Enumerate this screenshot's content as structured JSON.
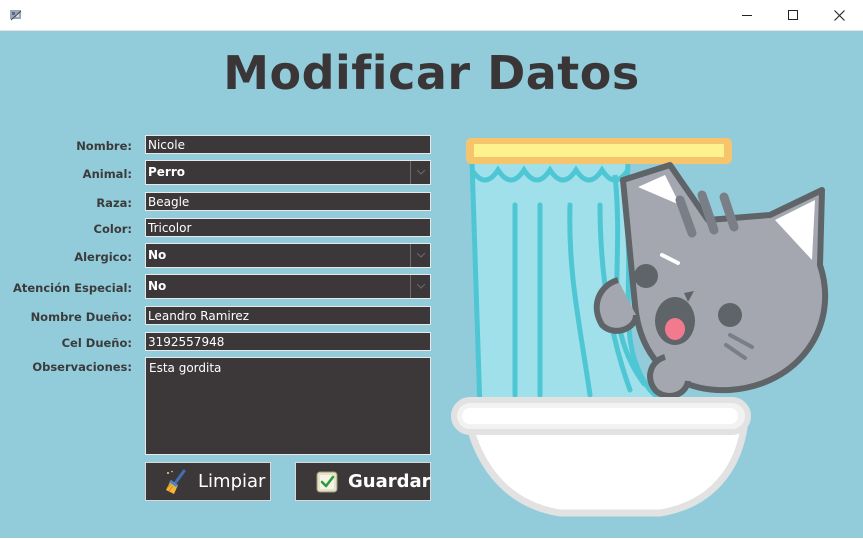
{
  "window": {
    "controls": {
      "minimize": "—",
      "maximize": "☐",
      "close": "✕"
    }
  },
  "heading": "Modificar Datos",
  "form": {
    "nombre_label": "Nombre:",
    "nombre_value": "Nicole",
    "animal_label": "Animal:",
    "animal_value": "Perro",
    "raza_label": "Raza:",
    "raza_value": "Beagle",
    "color_label": "Color:",
    "color_value": "Tricolor",
    "alergico_label": "Alergico:",
    "alergico_value": "No",
    "atencion_label": "Atención Especial:",
    "atencion_value": "No",
    "dueno_label": "Nombre Dueño:",
    "dueno_value": "Leandro Ramirez",
    "cel_label": "Cel Dueño:",
    "cel_value": "3192557948",
    "obs_label": "Observaciones:",
    "obs_value": "Esta gordita"
  },
  "buttons": {
    "clear_label": "Limpiar",
    "save_label": "Guardar"
  },
  "colors": {
    "background": "#92ccdb",
    "field_bg": "#3c3739",
    "heading": "#3a3536"
  },
  "illustration": "cat-in-bathtub-illustration"
}
